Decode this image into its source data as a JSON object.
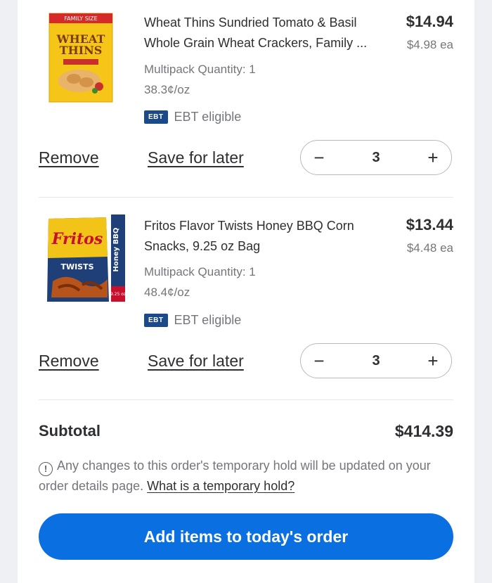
{
  "items": [
    {
      "title": "Wheat Thins Sundried Tomato & Basil Whole Grain Wheat Crackers, Family ...",
      "price": "$14.94",
      "unit_price": "$4.98 ea",
      "multipack": "Multipack Quantity: 1",
      "per_oz": "38.3¢/oz",
      "ebt_badge": "EBT",
      "ebt_text": "EBT eligible",
      "remove_label": "Remove",
      "save_label": "Save for later",
      "quantity": "3",
      "minus": "−",
      "plus": "+",
      "image_icon": "wheat-thins-box-image",
      "image_text": {
        "top": "FAMILY SIZE",
        "brand1": "WHEAT",
        "brand2": "THINS"
      }
    },
    {
      "title": "Fritos Flavor Twists Honey BBQ Corn Snacks, 9.25 oz Bag",
      "price": "$13.44",
      "unit_price": "$4.48 ea",
      "multipack": "Multipack Quantity: 1",
      "per_oz": "48.4¢/oz",
      "ebt_badge": "EBT",
      "ebt_text": "EBT eligible",
      "remove_label": "Remove",
      "save_label": "Save for later",
      "quantity": "3",
      "minus": "−",
      "plus": "+",
      "image_icon": "fritos-bag-image",
      "image_text": {
        "brand": "Fritos",
        "sub": "TWISTS",
        "side": "Honey BBQ",
        "size": "9.25 oz"
      }
    }
  ],
  "subtotal": {
    "label": "Subtotal",
    "value": "$414.39"
  },
  "notice": {
    "icon": "info-icon",
    "text": "Any changes to this order's temporary hold will be updated on your order details page.",
    "link": "What is a temporary hold?"
  },
  "cta": {
    "label": "Add items to today's order"
  },
  "colors": {
    "accent": "#0a6fe0",
    "ebt_badge": "#1a4a8a",
    "muted_text": "#74767c"
  }
}
